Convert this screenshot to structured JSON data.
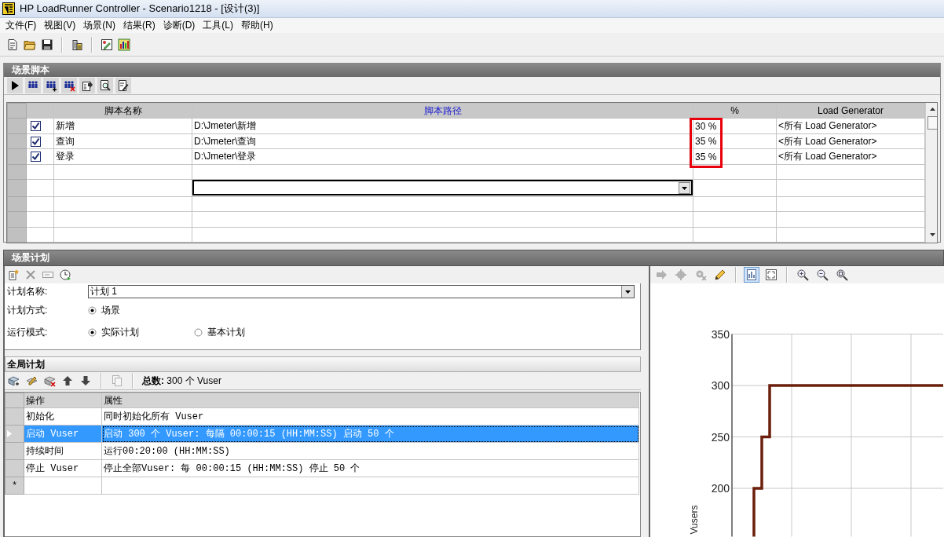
{
  "window": {
    "title": "HP LoadRunner Controller - Scenario1218 - [设计(3)]"
  },
  "menu": [
    "文件(F)",
    "视图(V)",
    "场景(N)",
    "结果(R)",
    "诊断(D)",
    "工具(L)",
    "帮助(H)"
  ],
  "scripts": {
    "title": "场景脚本",
    "percent_outlined": true,
    "columns": [
      {
        "label": "脚本名称",
        "selected": false
      },
      {
        "label": "脚本路径",
        "selected": true
      },
      {
        "label": "%",
        "selected": false
      },
      {
        "label": "Load Generator",
        "selected": false
      }
    ],
    "rows": [
      {
        "kind": "script",
        "checked": true,
        "editing": false,
        "name": "新增",
        "path": "D:\\Jmeter\\新增",
        "percent": "30 %",
        "load_generator": "<所有 Load Generator>"
      },
      {
        "kind": "script",
        "checked": true,
        "editing": false,
        "name": "查询",
        "path": "D:\\Jmeter\\查询",
        "percent": "35 %",
        "load_generator": "<所有 Load Generator>"
      },
      {
        "kind": "script",
        "checked": true,
        "editing": false,
        "name": "登录",
        "path": "D:\\Jmeter\\登录",
        "percent": "35 %",
        "load_generator": "<所有 Load Generator>"
      },
      {
        "kind": "empty",
        "editing": false
      },
      {
        "kind": "empty",
        "editing": true
      },
      {
        "kind": "empty",
        "editing": false
      },
      {
        "kind": "empty",
        "editing": false
      },
      {
        "kind": "empty",
        "editing": false
      }
    ]
  },
  "schedule": {
    "title": "场景计划",
    "toolbar": [
      {
        "disabled": false
      },
      {
        "disabled": true
      },
      {
        "disabled": true
      },
      {
        "disabled": false
      }
    ],
    "plan_name": {
      "label": "计划名称:",
      "value": "计划 1"
    },
    "plan_method": {
      "label": "计划方式:",
      "options": [
        {
          "label": "场景",
          "selected": true
        }
      ]
    },
    "run_mode": {
      "label": "运行模式:",
      "options": [
        {
          "label": "实际计划",
          "selected": true
        },
        {
          "label": "基本计划",
          "selected": false
        }
      ]
    }
  },
  "global_schedule": {
    "title": "全局计划",
    "toolbar": [
      {
        "disabled": false
      },
      {
        "disabled": false
      },
      {
        "disabled": false
      },
      {
        "disabled": false
      },
      {
        "disabled": false
      },
      {
        "disabled": true
      }
    ],
    "total": "**总数:** 300 个 Vuser",
    "columns": [
      "操作",
      "属性"
    ],
    "rows": [
      {
        "action": "初始化",
        "properties": "同时初始化所有 Vuser",
        "selected": false
      },
      {
        "action": "启动 Vuser",
        "properties": "启动 300 个 Vuser: 每隔 00:00:15 (HH:MM:SS) 启动 50 个",
        "selected": true
      },
      {
        "action": "持续时间",
        "properties": "运行00:20:00 (HH:MM:SS)",
        "selected": false
      },
      {
        "action": "停止 Vuser",
        "properties": "停止全部Vuser: 每 00:00:15 (HH:MM:SS) 停止 50 个",
        "selected": false
      }
    ],
    "new_row_marker": "*"
  },
  "chart": {
    "toolbar": [
      {
        "disabled": true,
        "selected": false
      },
      {
        "disabled": true,
        "selected": false
      },
      {
        "disabled": true,
        "selected": false
      },
      {
        "disabled": false,
        "selected": false
      },
      {
        "disabled": false,
        "selected": true
      },
      {
        "disabled": false,
        "selected": false
      },
      {
        "disabled": false,
        "selected": false
      },
      {
        "disabled": false,
        "selected": false
      },
      {
        "disabled": false,
        "selected": false
      }
    ],
    "y_tick_labels": [
      "350",
      "300",
      "250",
      "200"
    ],
    "y_title": "Vusers"
  }
}
